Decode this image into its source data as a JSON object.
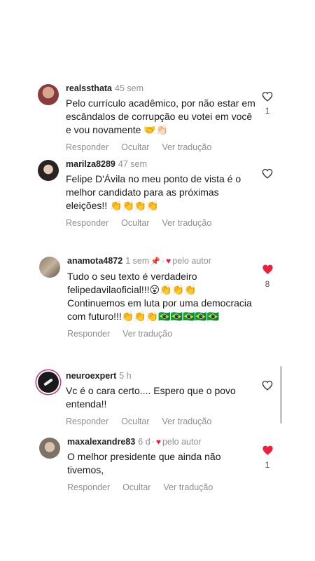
{
  "colors": {
    "like_red": "#ed1f3b",
    "meta_gray": "#8e8e8e"
  },
  "comments": [
    {
      "username": "realssthata",
      "time": "45 sem",
      "text_lines": [
        "Pelo currículo acadêmico, por não estar em",
        "escândalos de corrupção eu votei em você",
        "e vou novamente 🤝👏🏻"
      ],
      "actions": [
        "Responder",
        "Ocultar",
        "Ver tradução"
      ],
      "liked": false,
      "like_count": "1"
    },
    {
      "username": "marilza8289",
      "time": "47 sem",
      "text_lines": [
        "Felipe D'Ávila no meu ponto de vista é o",
        "melhor candidato para as próximas",
        "eleições!! 👏👏👏👏"
      ],
      "actions": [
        "Responder",
        "Ocultar",
        "Ver tradução"
      ],
      "liked": false,
      "like_count": ""
    },
    {
      "username": "anamota4872",
      "time": "1 sem",
      "pinned": true,
      "author_label": "pelo autor",
      "text_lines": [
        "Tudo o seu texto é verdadeiro",
        "felipedavilaoficial!!!😮👏👏👏",
        "Continuemos em luta por uma democracia",
        "com futuro!!!👏👏👏🇧🇷🇧🇷🇧🇷🇧🇷🇧🇷"
      ],
      "actions": [
        "Responder",
        "Ver tradução"
      ],
      "liked": true,
      "like_count": "8"
    },
    {
      "username": "neuroexpert",
      "time": "5 h",
      "text_lines": [
        "Vc é o cara certo.... Espero que o povo",
        "entenda!!"
      ],
      "actions": [
        "Responder",
        "Ocultar",
        "Ver tradução"
      ],
      "liked": false,
      "like_count": ""
    },
    {
      "username": "maxalexandre83",
      "time": "6 d",
      "author_label": "pelo autor",
      "text_lines": [
        "O melhor presidente que ainda não",
        "tivemos,"
      ],
      "actions": [
        "Responder",
        "Ocultar",
        "Ver tradução"
      ],
      "liked": true,
      "like_count": "1"
    }
  ]
}
